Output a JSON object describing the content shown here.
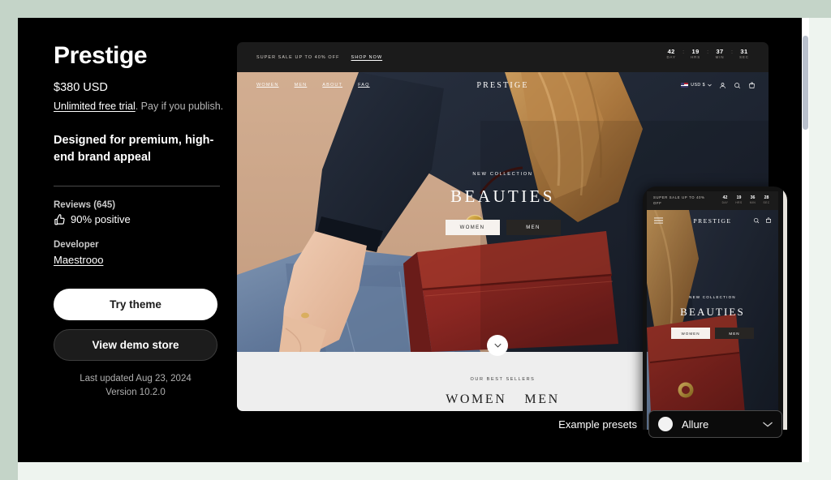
{
  "theme": {
    "title": "Prestige",
    "price": "$380 USD",
    "trial_link": "Unlimited free trial",
    "trial_rest": ". Pay if you publish.",
    "tagline": "Designed for premium, high-end brand appeal",
    "reviews_label": "Reviews (645)",
    "rating_text": "90% positive",
    "developer_label": "Developer",
    "developer_name": "Maestrooo",
    "try_button": "Try theme",
    "demo_button": "View demo store",
    "last_updated": "Last updated Aug 23, 2024",
    "version": "Version 10.2.0"
  },
  "preview": {
    "announcement": {
      "text": "SUPER SALE UP TO 40% OFF",
      "link": "SHOP NOW"
    },
    "countdown": [
      {
        "value": "42",
        "unit": "DAY"
      },
      {
        "value": "19",
        "unit": "HRS"
      },
      {
        "value": "37",
        "unit": "MIN"
      },
      {
        "value": "31",
        "unit": "SEC"
      }
    ],
    "nav": {
      "links": [
        "WOMEN",
        "MEN",
        "ABOUT",
        "FAQ"
      ],
      "brand": "PRESTIGE",
      "currency": "USD $"
    },
    "hero": {
      "eyebrow": "NEW COLLECTION",
      "title": "BEAUTIES",
      "button_women": "WOMEN",
      "button_men": "MEN"
    },
    "lower": {
      "eyebrow": "OUR BEST SELLERS",
      "headings": [
        "WOMEN",
        "MEN"
      ]
    }
  },
  "mobile": {
    "announcement_text": "SUPER SALE UP TO 40% OFF",
    "countdown": [
      {
        "value": "42",
        "unit": "DAY"
      },
      {
        "value": "19",
        "unit": "HRS"
      },
      {
        "value": "36",
        "unit": "MIN"
      },
      {
        "value": "28",
        "unit": "SEC"
      }
    ],
    "brand": "PRESTIGE",
    "hero": {
      "eyebrow": "NEW COLLECTION",
      "title": "BEAUTIES",
      "button_women": "WOMEN",
      "button_men": "MEN"
    }
  },
  "presets": {
    "label": "Example presets",
    "selected": "Allure"
  },
  "colors": {
    "page_bg": "#c4d4c8",
    "panel_bg": "#000000",
    "accent_white": "#ffffff",
    "bag_red": "#8e2a26"
  }
}
